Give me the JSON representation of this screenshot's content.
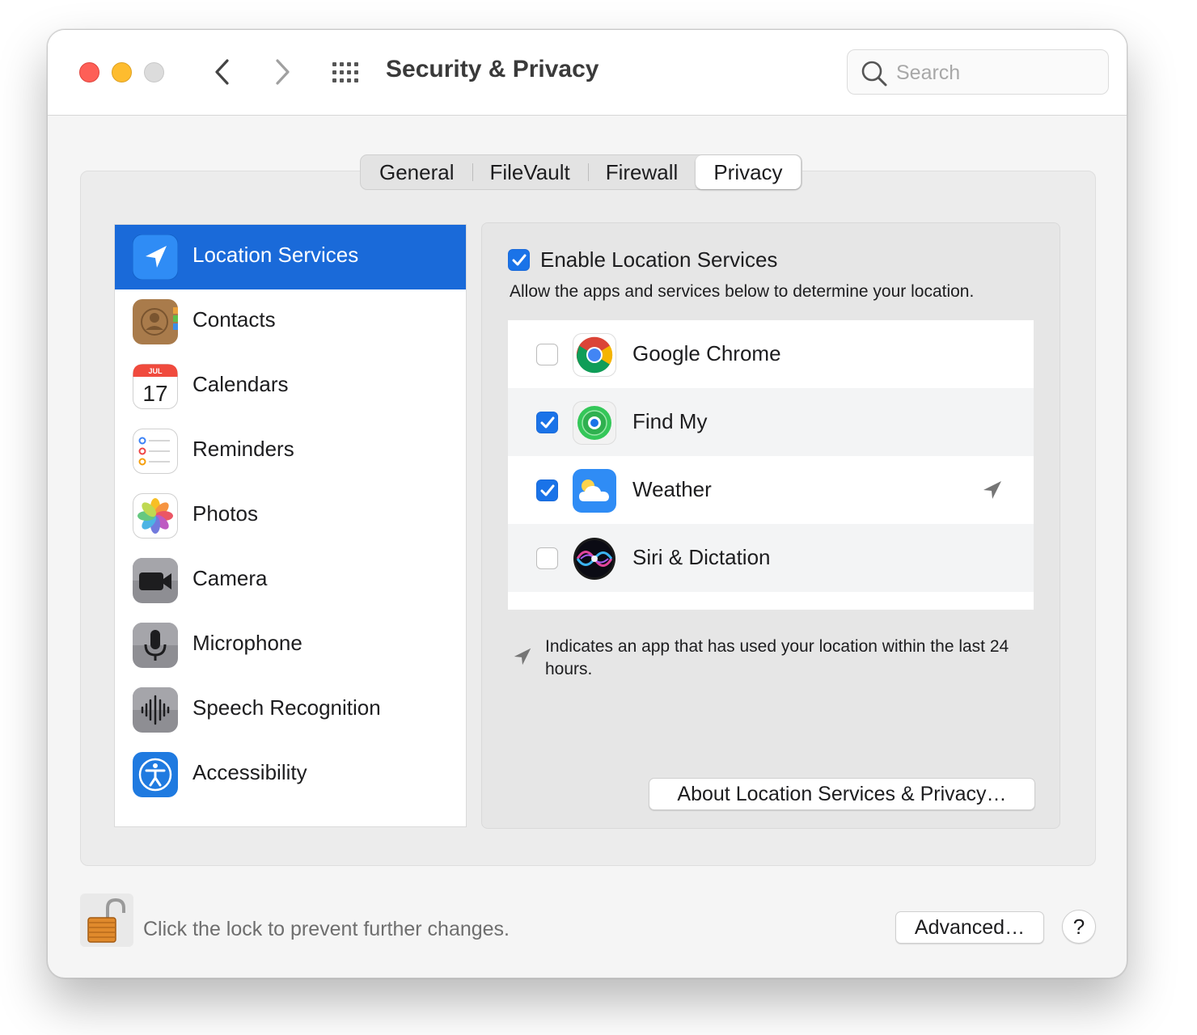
{
  "window": {
    "title": "Security & Privacy",
    "search_placeholder": "Search"
  },
  "tabs": [
    {
      "label": "General",
      "active": false
    },
    {
      "label": "FileVault",
      "active": false
    },
    {
      "label": "Firewall",
      "active": false
    },
    {
      "label": "Privacy",
      "active": true
    }
  ],
  "sidebar": {
    "items": [
      {
        "label": "Location Services",
        "icon": "location-icon",
        "selected": true
      },
      {
        "label": "Contacts",
        "icon": "contacts-icon"
      },
      {
        "label": "Calendars",
        "icon": "calendar-icon",
        "month": "JUL",
        "day": "17"
      },
      {
        "label": "Reminders",
        "icon": "reminders-icon"
      },
      {
        "label": "Photos",
        "icon": "photos-icon"
      },
      {
        "label": "Camera",
        "icon": "camera-icon"
      },
      {
        "label": "Microphone",
        "icon": "microphone-icon"
      },
      {
        "label": "Speech Recognition",
        "icon": "speech-recognition-icon"
      },
      {
        "label": "Accessibility",
        "icon": "accessibility-icon"
      }
    ]
  },
  "location": {
    "enable_label": "Enable Location Services",
    "enabled": true,
    "description": "Allow the apps and services below to determine your location.",
    "apps": [
      {
        "name": "Google Chrome",
        "icon": "chrome-icon",
        "checked": false,
        "recent_use": false
      },
      {
        "name": "Find My",
        "icon": "find-my-icon",
        "checked": true,
        "recent_use": false
      },
      {
        "name": "Weather",
        "icon": "weather-icon",
        "checked": true,
        "recent_use": true
      },
      {
        "name": "Siri & Dictation",
        "icon": "siri-icon",
        "checked": false,
        "recent_use": false
      }
    ],
    "legend": "Indicates an app that has used your location within the last 24 hours.",
    "about_button": "About Location Services & Privacy…"
  },
  "footer": {
    "lock_text": "Click the lock to prevent further changes.",
    "advanced_button": "Advanced…",
    "help_button": "?"
  },
  "colors": {
    "accent": "#1a6ad9",
    "checkbox_blue": "#1a73e8",
    "close": "#fe5f57",
    "minimize": "#febc2e"
  }
}
